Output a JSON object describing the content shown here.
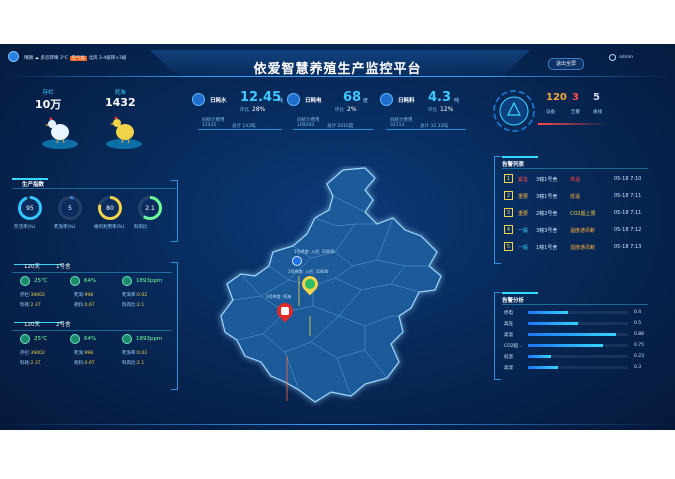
{
  "header": {
    "title": "依爱智慧养殖生产监控平台",
    "weather": [
      "晴朗",
      "多云转晴",
      "3°C",
      "空气优",
      "北风 3-4级转<3级"
    ],
    "exit_button": "退出全屏",
    "user": "admin"
  },
  "stock": {
    "inventory_label": "存栏",
    "inventory_value": "10万",
    "dead_label": "死淘",
    "dead_value": "1432"
  },
  "kpis": [
    {
      "label": "日耗水",
      "value": "12.45",
      "unit": "吨",
      "ring_label": "环比",
      "ring_value": "28%",
      "sub1": "同统计费用",
      "sub1_val": "12435",
      "sub2": "总计 143吨"
    },
    {
      "label": "日耗电",
      "value": "68",
      "unit": "度",
      "ring_label": "环比",
      "ring_value": "2%",
      "sub1": "同统计费用",
      "sub1_val": "109260",
      "sub2": "总计 2010度"
    },
    {
      "label": "日耗料",
      "value": "4.3",
      "unit": "吨",
      "ring_label": "环比",
      "ring_value": "12%",
      "sub1": "同统计费用",
      "sub1_val": "32113",
      "sub2": "总计 32.32吨"
    }
  ],
  "devices": {
    "online": "120",
    "online_label": "设备",
    "alarm": "3",
    "alarm_label": "告警",
    "offline": "5",
    "offline_label": "离线"
  },
  "production": {
    "title": "生产指数",
    "rings": [
      {
        "value": "95",
        "label": "存活率(%)",
        "color": "#33c6ff",
        "fraction": 0.95
      },
      {
        "value": "5",
        "label": "死淘率(%)",
        "color": "#3a7fd0",
        "fraction": 0.05
      },
      {
        "value": "80",
        "label": "格鸡利用率(%)",
        "color": "#f3d34a",
        "fraction": 0.8
      },
      {
        "value": "2.1",
        "label": "料肉比",
        "color": "#6dff9a",
        "fraction": 0.6
      }
    ]
  },
  "houses": [
    {
      "days": "120天",
      "name": "1号舍",
      "temp": "25℃",
      "humidity": "64%",
      "co2": "1893ppm",
      "stock_label": "存栏:",
      "stock": "39002",
      "dead_label": "死淘:",
      "dead": "998",
      "deadrate_label": "死淘率:",
      "deadrate": "0.02",
      "feed_label": "料耗:",
      "feed": "2.3T",
      "water_label": "耗料:",
      "water": "0.6T",
      "ratio_label": "料肉比:",
      "ratio": "2.1"
    },
    {
      "days": "120天",
      "name": "2号舍",
      "temp": "25℃",
      "humidity": "64%",
      "co2": "1893ppm",
      "stock_label": "存栏:",
      "stock": "39002",
      "dead_label": "死淘:",
      "dead": "998",
      "deadrate_label": "死淘率:",
      "deadrate": "0.02",
      "feed_label": "料耗:",
      "feed": "2.3T",
      "water_label": "耗料:",
      "water": "0.6T",
      "ratio_label": "料肉比:",
      "ratio": "2.1"
    }
  ],
  "alarm_list": {
    "title": "告警列表",
    "rows": [
      {
        "n": "1",
        "level": "紧急",
        "house": "3幢1号舍",
        "msg": "高温",
        "time": "05-18 7:10"
      },
      {
        "n": "2",
        "level": "重要",
        "house": "3幢1号舍",
        "msg": "低温",
        "time": "05-18 7:11"
      },
      {
        "n": "3",
        "level": "重要",
        "house": "2幢2号舍",
        "msg": "CO2超上限",
        "time": "05-18 7:11"
      },
      {
        "n": "4",
        "level": "一般",
        "house": "3幢3号舍",
        "msg": "温度通讯断",
        "time": "05-18 7:12"
      },
      {
        "n": "5",
        "level": "一般",
        "house": "1幢1号舍",
        "msg": "湿度通讯断",
        "time": "05-18 7:13"
      }
    ]
  },
  "alarm_analysis": {
    "title": "告警分析",
    "rows": [
      {
        "label": "停电",
        "value": "0.4",
        "fraction": 0.4
      },
      {
        "label": "高压",
        "value": "0.5",
        "fraction": 0.5
      },
      {
        "label": "高温",
        "value": "0.88",
        "fraction": 0.88
      },
      {
        "label": "CO2超...",
        "value": "0.75",
        "fraction": 0.75
      },
      {
        "label": "低温",
        "value": "0.23",
        "fraction": 0.23
      },
      {
        "label": "高湿",
        "value": "0.3",
        "fraction": 0.3
      }
    ]
  },
  "map": {
    "markers": [
      {
        "label": "1号鸡舍: 入栏, 10000"
      },
      {
        "label": "1号鸡舍: 入栏, 10000"
      },
      {
        "label": "1号鸡舍: 死淘"
      }
    ]
  },
  "colors": {
    "accent": "#38d7ff",
    "warn": "#f3d34a",
    "danger": "#ff4b4b"
  }
}
